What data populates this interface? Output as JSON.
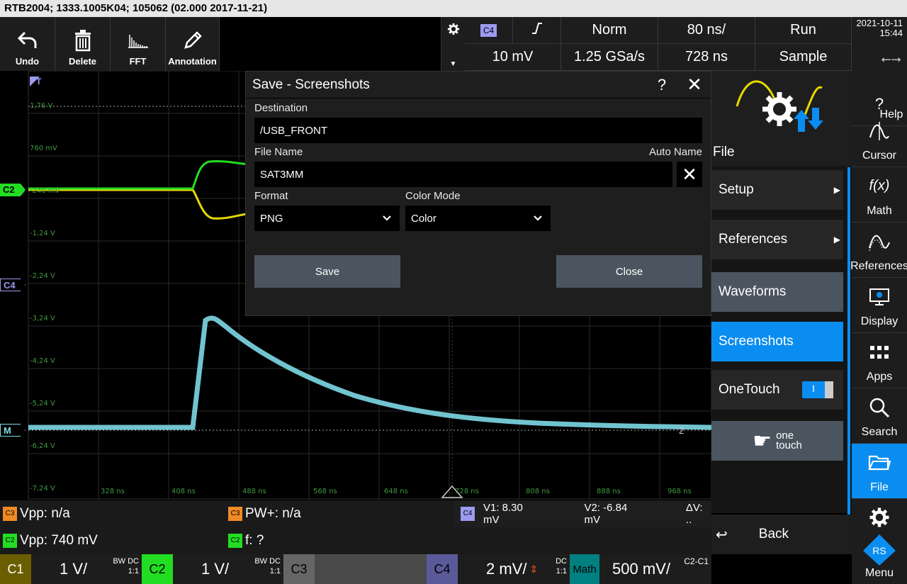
{
  "title": "RTB2004; 1333.1005K04; 105062 (02.000 2017-11-21)",
  "toolbar": {
    "undo": "Undo",
    "delete": "Delete",
    "fft": "FFT",
    "annotation": "Annotation"
  },
  "acq": {
    "channel": "C4",
    "norm": "Norm",
    "timebase": "80 ns/",
    "run": "Run",
    "level": "10 mV",
    "rate": "1.25 GSa/s",
    "position": "728 ns",
    "sample": "Sample"
  },
  "datetime": {
    "date": "2021-10-11",
    "time": "15:44"
  },
  "scope": {
    "ylabels": [
      "1,76 V",
      "760 mV",
      "-240 mV",
      "-1,24 V",
      "-2,24 V",
      "-3,24 V",
      "-4,24 V",
      "-5,24 V",
      "-6,24 V",
      "-7,24 V"
    ],
    "xlabels": [
      "328 ns",
      "408 ns",
      "488 ns",
      "568 ns",
      "648 ns",
      "728 ns",
      "808 ns",
      "888 ns",
      "968 ns"
    ],
    "markers": {
      "c2": "C2",
      "c4": "C4",
      "m": "M",
      "t": "T",
      "ref": "2"
    }
  },
  "dialog": {
    "title": "Save - Screenshots",
    "help": "?",
    "destination_label": "Destination",
    "destination_value": "/USB_FRONT",
    "filename_label": "File Name",
    "autoname_label": "Auto Name",
    "filename_value": "SAT3MM",
    "format_label": "Format",
    "format_value": "PNG",
    "colormode_label": "Color Mode",
    "colormode_value": "Color",
    "save": "Save",
    "close": "Close"
  },
  "menu": {
    "header": "File",
    "items": [
      "Setup",
      "References",
      "Waveforms",
      "Screenshots",
      "OneTouch"
    ],
    "onetouch_toggle": "I",
    "onetouch_one": "one",
    "onetouch_touch": "touch",
    "back": "Back"
  },
  "sidebar": [
    "Help",
    "Cursor",
    "Math",
    "References",
    "Display",
    "Apps",
    "Search",
    "File",
    "Menu"
  ],
  "measure": {
    "m1": "Vpp: n/a",
    "m2": "PW+: n/a",
    "m3": "Vpp: 740 mV",
    "m4": "f: ?",
    "c3_badge": "C3",
    "c2_badge": "C2",
    "v1": "V1: 8.30 mV",
    "v2": "V2: -6.84 mV",
    "dv": "ΔV: ..",
    "cursor_ch": "C4"
  },
  "channels": {
    "c1": {
      "tag": "C1",
      "scale": "1 V/",
      "bw": "BW DC",
      "ratio": "1:1"
    },
    "c2": {
      "tag": "C2",
      "scale": "1 V/",
      "bw": "BW DC",
      "ratio": "1:1"
    },
    "c3": {
      "tag": "C3"
    },
    "c4": {
      "tag": "C4",
      "scale": "2 mV/",
      "bw": "DC",
      "ratio": "1:1"
    },
    "math": {
      "tag": "Math",
      "scale": "500 mV/",
      "expr": "C2-C1"
    }
  },
  "colors": {
    "c1": "#e6c200",
    "c2": "#22dd22",
    "c3": "#f08a24",
    "c4": "#7dd9e6",
    "accent": "#0a8df0"
  }
}
